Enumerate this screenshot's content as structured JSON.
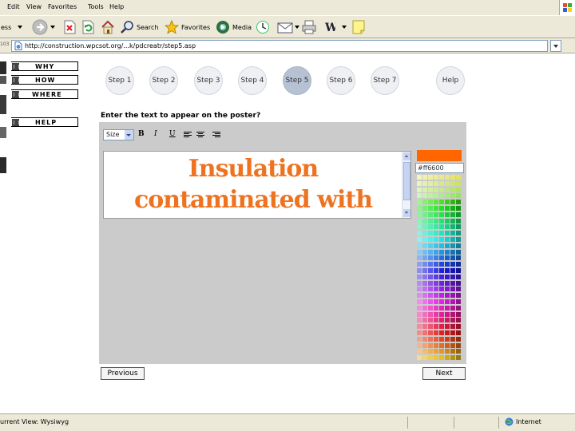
{
  "browser": {
    "menu": [
      "Edit",
      "View",
      "Favorites",
      "Tools",
      "Help"
    ],
    "toolbar": {
      "search_label": "Search",
      "favorites_label": "Favorites",
      "media_label": "Media"
    },
    "address_prefix": "ess",
    "address_url": "http://construction.wpcsot.org/...k/pdcreatr/step5.asp",
    "zoom_corner": "103"
  },
  "left_nav": [
    "WHY",
    "HOW",
    "WHERE",
    "HELP"
  ],
  "steps": [
    {
      "label": "Step 1",
      "active": false
    },
    {
      "label": "Step 2",
      "active": false
    },
    {
      "label": "Step 3",
      "active": false
    },
    {
      "label": "Step 4",
      "active": false
    },
    {
      "label": "Step 5",
      "active": true
    },
    {
      "label": "Step 6",
      "active": false
    },
    {
      "label": "Step 7",
      "active": false
    }
  ],
  "help_label": "Help",
  "editor": {
    "question": "Enter the text to appear on the poster?",
    "size_select": "Size",
    "bold": "B",
    "italic": "I",
    "underline": "U",
    "poster_text": [
      "Insulation",
      "contaminated with"
    ],
    "text_color": "#ee7320",
    "selected_color": "#ff6600",
    "selected_hex": "#ff6600"
  },
  "buttons": {
    "previous": "Previous",
    "next": "Next"
  },
  "status": {
    "left": "urrent View: Wysiwyg",
    "zone": "Internet"
  },
  "colors": {
    "chrome": "#ece9d8",
    "panel": "#cbcbcb",
    "step_active": "#b6c2d4"
  }
}
